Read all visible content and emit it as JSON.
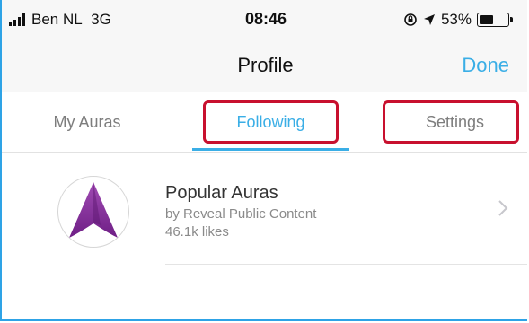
{
  "status_bar": {
    "carrier": "Ben NL",
    "network": "3G",
    "time": "08:46",
    "battery_percent": "53%",
    "battery_level": 0.53
  },
  "nav_bar": {
    "title": "Profile",
    "done_label": "Done"
  },
  "tabs": [
    {
      "label": "My Auras",
      "selected": false
    },
    {
      "label": "Following",
      "selected": true
    },
    {
      "label": "Settings",
      "selected": false
    }
  ],
  "list": [
    {
      "title": "Popular Auras",
      "subtitle": "by Reveal Public Content",
      "likes": "46.1k likes",
      "icon": "aura-logo-icon"
    }
  ],
  "colors": {
    "accent": "#3aaee6",
    "highlight": "#c8102e",
    "logo_purple": "#8e2f9e"
  }
}
